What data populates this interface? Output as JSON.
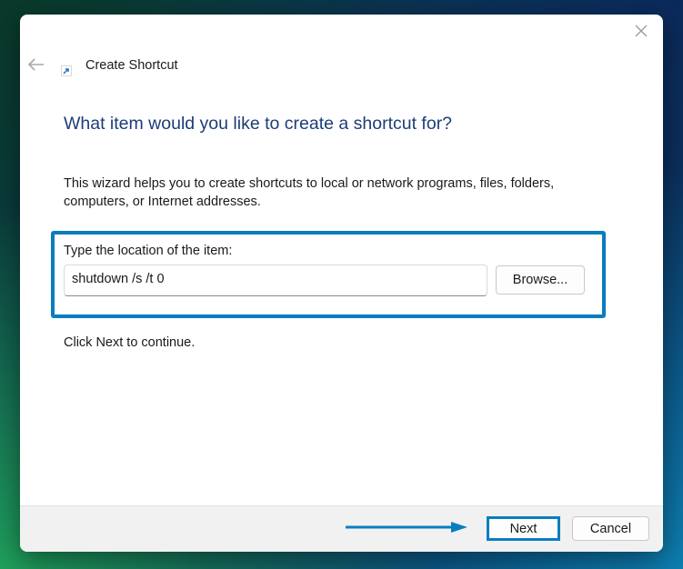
{
  "window": {
    "title": "Create Shortcut",
    "close_icon": "close-icon",
    "back_icon": "back-arrow-icon",
    "app_icon": "shortcut-icon"
  },
  "content": {
    "heading": "What item would you like to create a shortcut for?",
    "description": "This wizard helps you to create shortcuts to local or network programs, files, folders, computers, or Internet addresses.",
    "location_label": "Type the location of the item:",
    "location_value": "shutdown /s /t 0",
    "browse_label": "Browse...",
    "hint": "Click Next to continue."
  },
  "footer": {
    "next_label": "Next",
    "cancel_label": "Cancel"
  },
  "colors": {
    "heading": "#1c3d78",
    "annotation": "#0a7dbf",
    "footer_bg": "#f1f1f1"
  }
}
